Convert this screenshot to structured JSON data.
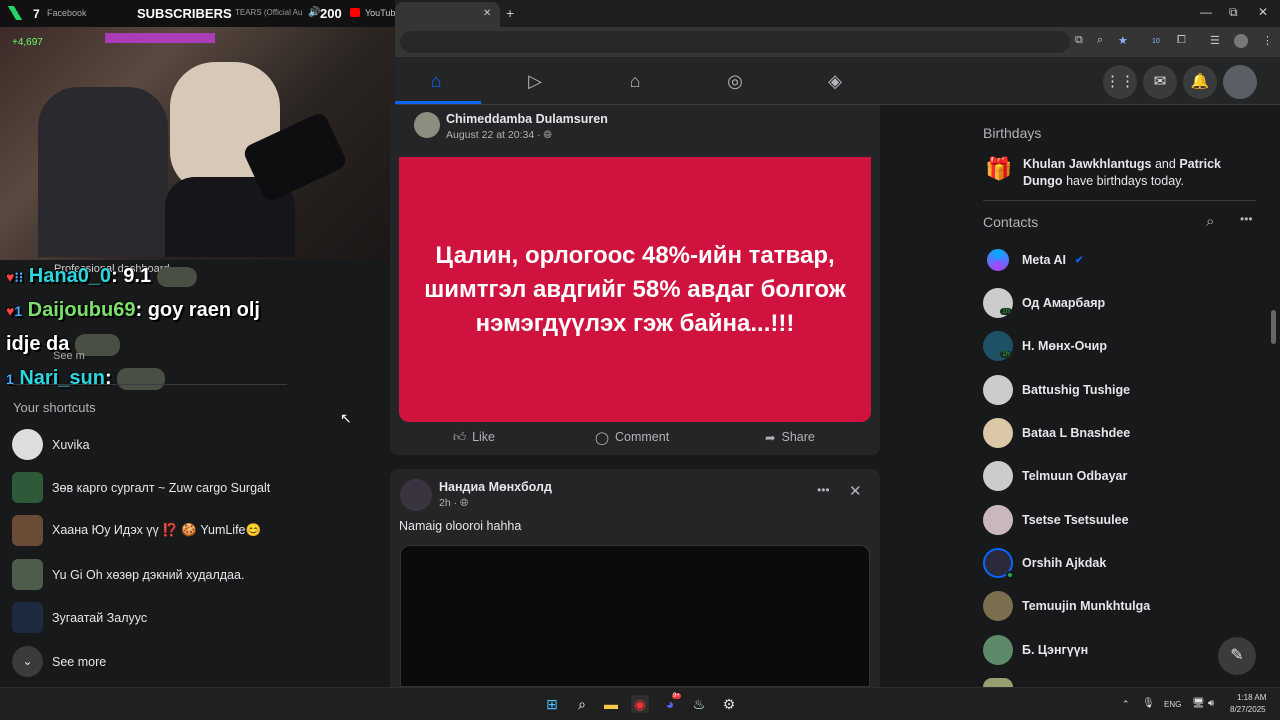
{
  "browser": {
    "tab1_title": "Facebook",
    "tab1_count": "7",
    "tab2_title": "YouTube",
    "tab_marquee": "TEARS (Official Au",
    "new_tab": "+",
    "tab_close": "✕",
    "win_min": "—",
    "win_max": "⧉",
    "win_close": "✕"
  },
  "stream_overlay": {
    "subscribers_label": "SUBSCRIBERS",
    "subscribers_count": "200",
    "viewer_tag": "+4,697",
    "chat": [
      {
        "user": "Hana0_0",
        "text": "9.1"
      },
      {
        "user": "Daijoubu69",
        "text": "goy raen olj"
      },
      {
        "user": "",
        "text": "idje da"
      },
      {
        "user": "Nari_sun",
        "text": ""
      }
    ],
    "overlap_text_1": "Professional dashboard",
    "overlap_text_2": "See m"
  },
  "left_sidebar": {
    "shortcuts_heading": "Your shortcuts",
    "shortcuts": [
      {
        "label": "Xuvika"
      },
      {
        "label": "Зөв карго сургалт ~ Zuw cargo Surgalt"
      },
      {
        "label": "Хаана Юу Идэх үү ⁉️ 🍪 YumLife😊"
      },
      {
        "label": "Yu Gi Oh хөзөр дэкний худалдаа."
      },
      {
        "label": "Зугаатай Залуус"
      }
    ],
    "see_more": "See more"
  },
  "feed": {
    "post1": {
      "author": "Chimeddamba Dulamsuren",
      "time": "August 22 at 20:34 · ",
      "image_text": "Цалин, орлогоос 48%-ийн татвар, шимтгэл авдгийг 58% авдаг болгож нэмэгдүүлэх гэж байна...!!!",
      "image_bg": "#d0123f",
      "actions": {
        "like": "Like",
        "comment": "Comment",
        "share": "Share"
      }
    },
    "post2": {
      "author": "Нандиа Мөнхболд",
      "time": "2h · ",
      "text": "Namaig olooroi hahha",
      "more": "•••",
      "close": "✕"
    }
  },
  "right_sidebar": {
    "birthdays_heading": "Birthdays",
    "birthday_name1": "Khulan Jawkhlantugs",
    "birthday_and": " and ",
    "birthday_name2": "Patrick Dungo",
    "birthday_tail": "have birthdays today.",
    "contacts_heading": "Contacts",
    "contacts": [
      {
        "name": "Meta AI",
        "badge": ""
      },
      {
        "name": "Од Амарбаяр",
        "badge": "1h"
      },
      {
        "name": "Н. Мөнх-Очир",
        "badge": "1h"
      },
      {
        "name": "Battushig Tushige",
        "badge": ""
      },
      {
        "name": "Bataa L Bnashdee",
        "badge": ""
      },
      {
        "name": "Telmuun Odbayar",
        "badge": ""
      },
      {
        "name": "Tsetse Tsetsuulee",
        "badge": ""
      },
      {
        "name": "Orshih Ajkdak",
        "badge": ""
      },
      {
        "name": "Temuujin Munkhtulga",
        "badge": ""
      },
      {
        "name": "Б. Цэнгүүн",
        "badge": ""
      }
    ]
  },
  "taskbar": {
    "lang": "ENG",
    "time": "1:18 AM",
    "date": "8/27/2025",
    "discord_badge": "9+",
    "extension_badge": "10"
  },
  "colors": {
    "fb_blue": "#0866ff",
    "accent_green": "#31a24c"
  }
}
